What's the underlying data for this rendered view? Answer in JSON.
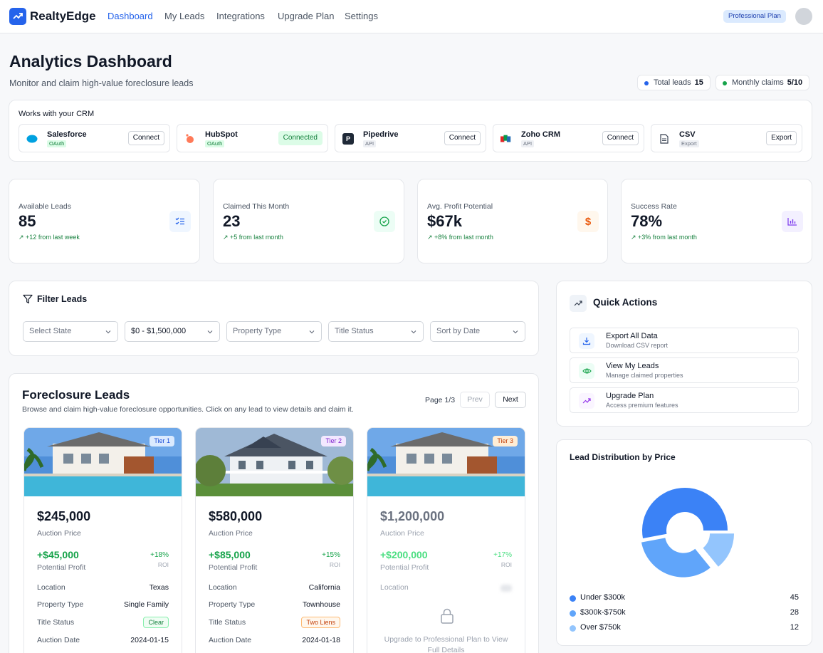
{
  "app": {
    "name": "RealtyEdge",
    "plan_badge": "Professional Plan"
  },
  "nav": [
    {
      "label": "Dashboard",
      "active": true
    },
    {
      "label": "My Leads"
    },
    {
      "label": "Integrations"
    },
    {
      "label": "Upgrade Plan"
    },
    {
      "label": "Settings"
    }
  ],
  "page": {
    "title": "Analytics Dashboard",
    "subtitle": "Monitor and claim high-value foreclosure leads",
    "total_leads_label": "Total leads",
    "total_leads_value": "15",
    "monthly_claims_label": "Monthly claims",
    "monthly_claims_value": "5/10"
  },
  "crm": {
    "title": "Works with your CRM",
    "items": [
      {
        "name": "Salesforce",
        "tag": "OAuth",
        "button": "Connect",
        "icon": "salesforce-icon"
      },
      {
        "name": "HubSpot",
        "tag": "OAuth",
        "button": "Connected",
        "icon": "hubspot-icon"
      },
      {
        "name": "Pipedrive",
        "tag": "API",
        "button": "Connect",
        "icon": "pipedrive-icon",
        "icon_letter": "P"
      },
      {
        "name": "Zoho CRM",
        "tag": "API",
        "button": "Connect",
        "icon": "zoho-icon"
      },
      {
        "name": "CSV",
        "tag": "Export",
        "button": "Export",
        "icon": "file-icon"
      }
    ]
  },
  "stats": [
    {
      "label": "Available Leads",
      "value": "85",
      "change": "+12 from last week",
      "icon": "checklist-icon",
      "color": "#2563eb"
    },
    {
      "label": "Claimed This Month",
      "value": "23",
      "change": "+5 from last month",
      "icon": "check-circle-icon",
      "color": "#16a34a"
    },
    {
      "label": "Avg. Profit Potential",
      "value": "$67k",
      "change": "+8% from last month",
      "icon": "dollar-icon",
      "color": "#ea580c"
    },
    {
      "label": "Success Rate",
      "value": "78%",
      "change": "+3% from last month",
      "icon": "bar-chart-icon",
      "color": "#7c3aed"
    }
  ],
  "filters": {
    "title": "Filter Leads",
    "selects": [
      "Select State",
      "$0 - $1,500,000",
      "Property Type",
      "Title Status",
      "Sort by Date"
    ]
  },
  "leads": {
    "title": "Foreclosure Leads",
    "subtitle": "Browse and claim high-value foreclosure opportunities. Click on any lead to view details and claim it.",
    "page": "Page 1/3",
    "prev": "Prev",
    "next": "Next",
    "labels": {
      "auction_price": "Auction Price",
      "potential_profit": "Potential Profit",
      "roi": "ROI",
      "location": "Location",
      "property_type": "Property Type",
      "title_status": "Title Status",
      "auction_date": "Auction Date"
    },
    "cards": [
      {
        "tier": "Tier 1",
        "price": "$245,000",
        "profit": "+$45,000",
        "roi": "+18%",
        "location": "Texas",
        "property_type": "Single Family",
        "title_status": "Clear",
        "auction_date": "2024-01-15"
      },
      {
        "tier": "Tier 2",
        "price": "$580,000",
        "profit": "+$85,000",
        "roi": "+15%",
        "location": "California",
        "property_type": "Townhouse",
        "title_status": "Two Liens",
        "auction_date": "2024-01-18"
      },
      {
        "tier": "Tier 3",
        "price": "$1,200,000",
        "profit": "+$200,000",
        "roi": "+17%",
        "locked_message": "Upgrade to Professional Plan to View Full Details"
      }
    ]
  },
  "quick_actions": {
    "title": "Quick Actions",
    "items": [
      {
        "title": "Export All Data",
        "sub": "Download CSV report",
        "icon": "download-icon"
      },
      {
        "title": "View My Leads",
        "sub": "Manage claimed properties",
        "icon": "eye-icon"
      },
      {
        "title": "Upgrade Plan",
        "sub": "Access premium features",
        "icon": "trend-up-icon"
      }
    ]
  },
  "distribution": {
    "title": "Lead Distribution by Price",
    "chart_data": {
      "type": "pie",
      "categories": [
        "Under $300k",
        "$300k-$750k",
        "Over $750k"
      ],
      "values": [
        45,
        28,
        12
      ],
      "colors": [
        "#3b82f6",
        "#60a5fa",
        "#93c5fd"
      ]
    }
  }
}
